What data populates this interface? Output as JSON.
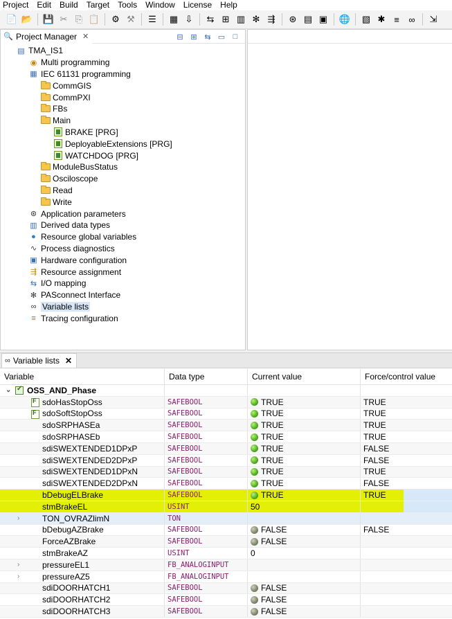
{
  "menu": [
    "Project",
    "Edit",
    "Build",
    "Target",
    "Tools",
    "Window",
    "License",
    "Help"
  ],
  "project_manager": {
    "tab_title": "Project Manager",
    "tree": [
      {
        "label": "TMA_IS1",
        "level": 0,
        "icon": "project-icon"
      },
      {
        "label": "Multi programming",
        "level": 1,
        "icon": "multi-programming-icon"
      },
      {
        "label": "IEC 61131 programming",
        "level": 1,
        "icon": "iec-programming-icon"
      },
      {
        "label": "CommGIS",
        "level": 2,
        "icon": "folder-icon"
      },
      {
        "label": "CommPXI",
        "level": 2,
        "icon": "folder-icon"
      },
      {
        "label": "FBs",
        "level": 2,
        "icon": "folder-icon"
      },
      {
        "label": "Main",
        "level": 2,
        "icon": "folder-icon"
      },
      {
        "label": "BRAKE [PRG]",
        "level": 3,
        "icon": "program-icon"
      },
      {
        "label": "DeployableExtensions [PRG]",
        "level": 3,
        "icon": "program-icon"
      },
      {
        "label": "WATCHDOG [PRG]",
        "level": 3,
        "icon": "program-icon"
      },
      {
        "label": "ModuleBusStatus",
        "level": 2,
        "icon": "folder-icon"
      },
      {
        "label": "Osciloscope",
        "level": 2,
        "icon": "folder-icon"
      },
      {
        "label": "Read",
        "level": 2,
        "icon": "folder-icon"
      },
      {
        "label": "Write",
        "level": 2,
        "icon": "folder-icon"
      },
      {
        "label": "Application parameters",
        "level": 1,
        "icon": "application-parameters-icon"
      },
      {
        "label": "Derived data types",
        "level": 1,
        "icon": "derived-data-types-icon"
      },
      {
        "label": "Resource global variables",
        "level": 1,
        "icon": "globe-icon"
      },
      {
        "label": "Process diagnostics",
        "level": 1,
        "icon": "process-diagnostics-icon"
      },
      {
        "label": "Hardware configuration",
        "level": 1,
        "icon": "hardware-configuration-icon"
      },
      {
        "label": "Resource assignment",
        "level": 1,
        "icon": "resource-assignment-icon"
      },
      {
        "label": "I/O mapping",
        "level": 1,
        "icon": "io-mapping-icon"
      },
      {
        "label": "PASconnect Interface",
        "level": 1,
        "icon": "pasconnect-icon"
      },
      {
        "label": "Variable lists",
        "level": 1,
        "icon": "variable-lists-icon",
        "selected": true
      },
      {
        "label": "Tracing configuration",
        "level": 1,
        "icon": "tracing-configuration-icon"
      }
    ]
  },
  "variable_lists": {
    "tab_title": "Variable lists",
    "columns": [
      "Variable",
      "Data type",
      "Current value",
      "Force/control value"
    ],
    "group": "OSS_AND_Phase",
    "rows": [
      {
        "name": "sdoHasStopOss",
        "type": "SAFEBOOL",
        "value": "TRUE",
        "state": "on",
        "force": "TRUE",
        "icon": "fb"
      },
      {
        "name": "sdoSoftStopOss",
        "type": "SAFEBOOL",
        "value": "TRUE",
        "state": "on",
        "force": "TRUE",
        "icon": "fb"
      },
      {
        "name": "sdoSRPHASEa",
        "type": "SAFEBOOL",
        "value": "TRUE",
        "state": "on",
        "force": "TRUE"
      },
      {
        "name": "sdoSRPHASEb",
        "type": "SAFEBOOL",
        "value": "TRUE",
        "state": "on",
        "force": "TRUE"
      },
      {
        "name": "sdiSWEXTENDED1DPxP",
        "type": "SAFEBOOL",
        "value": "TRUE",
        "state": "on",
        "force": "FALSE"
      },
      {
        "name": "sdiSWEXTENDED2DPxP",
        "type": "SAFEBOOL",
        "value": "TRUE",
        "state": "on",
        "force": "FALSE"
      },
      {
        "name": "sdiSWEXTENDED1DPxN",
        "type": "SAFEBOOL",
        "value": "TRUE",
        "state": "on",
        "force": "TRUE"
      },
      {
        "name": "sdiSWEXTENDED2DPxN",
        "type": "SAFEBOOL",
        "value": "TRUE",
        "state": "on",
        "force": "FALSE"
      },
      {
        "name": "bDebugELBrake",
        "type": "SAFEBOOL",
        "value": "TRUE",
        "state": "on",
        "force": "TRUE",
        "highlight": true
      },
      {
        "name": "stmBrakeEL",
        "type": "USINT",
        "value": "50",
        "state": "",
        "force": "",
        "highlight": true
      },
      {
        "name": "TON_OVRAZlimN",
        "type": "TON",
        "value": "",
        "state": "",
        "force": "",
        "expandable": true,
        "selected": true
      },
      {
        "name": "bDebugAZBrake",
        "type": "SAFEBOOL",
        "value": "FALSE",
        "state": "off",
        "force": "FALSE"
      },
      {
        "name": "ForceAZBrake",
        "type": "SAFEBOOL",
        "value": "FALSE",
        "state": "off",
        "force": ""
      },
      {
        "name": "stmBrakeAZ",
        "type": "USINT",
        "value": "0",
        "state": "",
        "force": ""
      },
      {
        "name": "pressureEL1",
        "type": "FB_ANALOGINPUT",
        "value": "",
        "state": "",
        "force": "",
        "expandable": true
      },
      {
        "name": "pressureAZ5",
        "type": "FB_ANALOGINPUT",
        "value": "",
        "state": "",
        "force": "",
        "expandable": true
      },
      {
        "name": "sdiDOORHATCH1",
        "type": "SAFEBOOL",
        "value": "FALSE",
        "state": "off",
        "force": ""
      },
      {
        "name": "sdiDOORHATCH2",
        "type": "SAFEBOOL",
        "value": "FALSE",
        "state": "off",
        "force": ""
      },
      {
        "name": "sdiDOORHATCH3",
        "type": "SAFEBOOL",
        "value": "FALSE",
        "state": "off",
        "force": ""
      }
    ]
  }
}
